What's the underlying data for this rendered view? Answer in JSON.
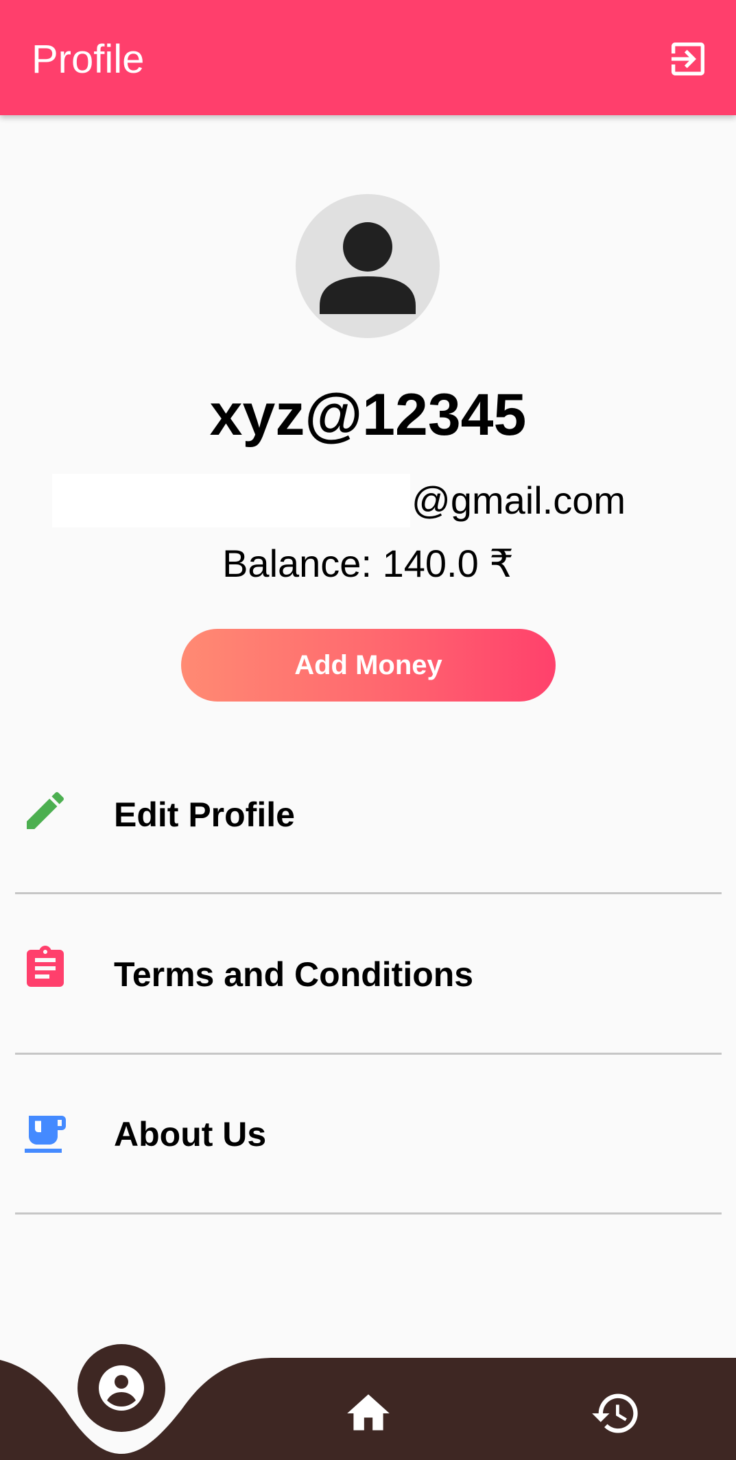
{
  "appbar": {
    "title": "Profile",
    "logout_icon": "logout-icon",
    "color": "#ff3f6c"
  },
  "profile": {
    "avatar_icon": "person-icon",
    "username": "xyz@12345",
    "email_domain": "@gmail.com",
    "balance_label": "Balance:",
    "balance_value": "140.0 ₹",
    "add_money_label": "Add Money"
  },
  "menu": [
    {
      "label": "Edit Profile",
      "icon": "pencil-icon",
      "icon_color": "#4caf50"
    },
    {
      "label": "Terms and Conditions",
      "icon": "clipboard-icon",
      "icon_color": "#ff3f6c"
    },
    {
      "label": "About Us",
      "icon": "coffee-cup-icon",
      "icon_color": "#448aff"
    }
  ],
  "bottom_nav": {
    "items": [
      {
        "icon": "account-circle-icon",
        "active": true
      },
      {
        "icon": "home-icon",
        "active": false
      },
      {
        "icon": "history-icon",
        "active": false
      }
    ],
    "background": "#3e2723"
  }
}
